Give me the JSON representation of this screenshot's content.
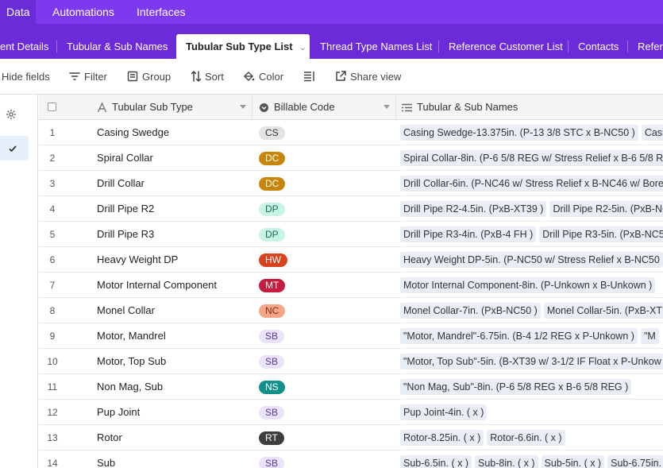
{
  "topnav": {
    "items": [
      {
        "label": "Data",
        "active": true
      },
      {
        "label": "Automations"
      },
      {
        "label": "Interfaces"
      }
    ]
  },
  "tabs": [
    {
      "label": "ent Details"
    },
    {
      "label": "Tubular & Sub Names"
    },
    {
      "label": "Tubular Sub Type List",
      "active": true
    },
    {
      "label": "Thread Type Names List"
    },
    {
      "label": "Reference Customer List"
    },
    {
      "label": "Contacts"
    },
    {
      "label": "Refer"
    }
  ],
  "toolbar": {
    "hide_fields": "Hide fields",
    "filter": "Filter",
    "group": "Group",
    "sort": "Sort",
    "color": "Color",
    "share_view": "Share view"
  },
  "columns": {
    "sub_type": "Tubular Sub Type",
    "billable_code": "Billable Code",
    "tubular_sub_names": "Tubular & Sub Names"
  },
  "colors": {
    "accent": "#7c39ed",
    "tabbar": "#6c2bd9",
    "selection": "#e5f0fb"
  },
  "rows": [
    {
      "num": "1",
      "name": "Casing Swedge",
      "code": "CS",
      "badge_bg": "#e4e4e4",
      "badge_fg": "#333333",
      "links": [
        "Casing Swedge-13.375in. (P-13 3/8 STC x B-NC50 )",
        "Casing"
      ]
    },
    {
      "num": "2",
      "name": "Spiral Collar",
      "code": "DC",
      "badge_bg": "#c7850b",
      "badge_fg": "#ffffff",
      "links": [
        "Spiral Collar-8in. (P-6 5/8 REG w/ Stress Relief x B-6 5/8 REG"
      ]
    },
    {
      "num": "3",
      "name": "Drill Collar",
      "code": "DC",
      "badge_bg": "#c7850b",
      "badge_fg": "#ffffff",
      "links": [
        "Drill Collar-6in. (P-NC46 w/ Stress Relief x B-NC46 w/ Bore"
      ]
    },
    {
      "num": "4",
      "name": "Drill Pipe R2",
      "code": "DP",
      "badge_bg": "#c8f3e6",
      "badge_fg": "#1d6b55",
      "links": [
        "Drill Pipe R2-4.5in. (PxB-XT39 )",
        "Drill Pipe R2-5in. (PxB-NC"
      ]
    },
    {
      "num": "5",
      "name": "Drill Pipe R3",
      "code": "DP",
      "badge_bg": "#c8f3e6",
      "badge_fg": "#1d6b55",
      "links": [
        "Drill Pipe R3-4in. (PxB-4 FH )",
        "Drill Pipe R3-5in. (PxB-NC5"
      ]
    },
    {
      "num": "6",
      "name": "Heavy Weight DP",
      "code": "HW",
      "badge_bg": "#d8431f",
      "badge_fg": "#ffffff",
      "links": [
        "Heavy Weight DP-5in. (P-NC50 w/ Stress Relief x B-NC50"
      ]
    },
    {
      "num": "7",
      "name": "Motor Internal Component",
      "code": "MT",
      "badge_bg": "#c51d3f",
      "badge_fg": "#ffffff",
      "links": [
        "Motor Internal Component-8in. (P-Unkown x B-Unkown )"
      ]
    },
    {
      "num": "8",
      "name": "Monel Collar",
      "code": "NC",
      "badge_bg": "#f5a687",
      "badge_fg": "#7a2e12",
      "links": [
        "Monel Collar-7in. (PxB-NC50 )",
        "Monel Collar-5in. (PxB-XT"
      ]
    },
    {
      "num": "9",
      "name": "Motor, Mandrel",
      "code": "SB",
      "badge_bg": "#ebe3fb",
      "badge_fg": "#5a3aa3",
      "links": [
        "\"Motor, Mandrel\"-6.75in. (B-4 1/2 REG x P-Unkown )",
        "\"M"
      ]
    },
    {
      "num": "10",
      "name": "Motor, Top Sub",
      "code": "SB",
      "badge_bg": "#ebe3fb",
      "badge_fg": "#5a3aa3",
      "links": [
        "\"Motor, Top Sub\"-5in. (B-XT39 w/ 3-1/2 IF Float x P-Unkow"
      ]
    },
    {
      "num": "11",
      "name": "Non Mag, Sub",
      "code": "NS",
      "badge_bg": "#13908a",
      "badge_fg": "#ffffff",
      "links": [
        "\"Non Mag, Sub\"-8in. (P-6 5/8 REG x B-6 5/8 REG )"
      ]
    },
    {
      "num": "12",
      "name": "Pup Joint",
      "code": "SB",
      "badge_bg": "#ebe3fb",
      "badge_fg": "#5a3aa3",
      "links": [
        "Pup Joint-4in. ( x )"
      ]
    },
    {
      "num": "13",
      "name": "Rotor",
      "code": "RT",
      "badge_bg": "#3d3d3d",
      "badge_fg": "#ffffff",
      "links": [
        "Rotor-8.25in. ( x )",
        "Rotor-6.6in. ( x )"
      ]
    },
    {
      "num": "14",
      "name": "Sub",
      "code": "SB",
      "badge_bg": "#ebe3fb",
      "badge_fg": "#5a3aa3",
      "links": [
        "Sub-6.5in. ( x )",
        "Sub-8in. ( x )",
        "Sub-5in. ( x )",
        "Sub-6.75in."
      ]
    }
  ]
}
